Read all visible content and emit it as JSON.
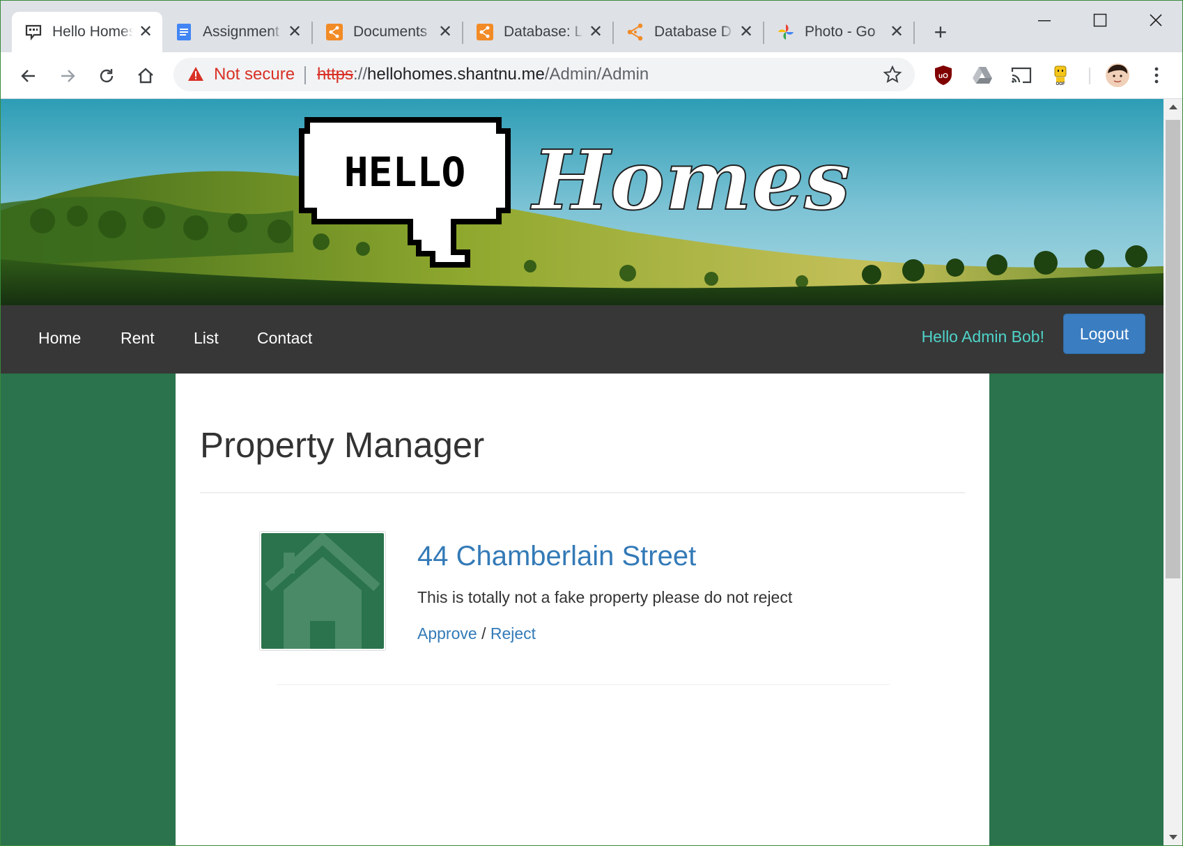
{
  "browser": {
    "tabs": [
      {
        "title": "Hello Homes",
        "icon": "hello-homes-favicon",
        "active": true
      },
      {
        "title": "Assignment",
        "icon": "google-docs-icon",
        "active": false
      },
      {
        "title": "Documents",
        "icon": "layers-icon",
        "active": false
      },
      {
        "title": "Database: L",
        "icon": "layers-icon",
        "active": false
      },
      {
        "title": "Database D",
        "icon": "share-nodes-icon",
        "active": false
      },
      {
        "title": "Photo - Go",
        "icon": "google-photos-icon",
        "active": false
      }
    ],
    "new_tab": "+",
    "window_controls": {
      "minimize": "—",
      "maximize": "☐",
      "close": "✕"
    },
    "security_label": "Not secure",
    "url": {
      "scheme": "https",
      "separator": "://",
      "host": "hellohomes.shantnu.me",
      "path": "/Admin/Admin"
    }
  },
  "site": {
    "logo": {
      "bubble_text": "HELLO",
      "script_text": "Homes"
    },
    "nav": [
      "Home",
      "Rent",
      "List",
      "Contact"
    ],
    "greeting": "Hello Admin Bob!",
    "logout_label": "Logout"
  },
  "page": {
    "title": "Property Manager",
    "properties": [
      {
        "name": "44 Chamberlain Street",
        "description": "This is totally not a fake property please do not reject",
        "approve_label": "Approve",
        "separator": "/",
        "reject_label": "Reject"
      }
    ]
  },
  "colors": {
    "page_background": "#2a734c",
    "navbar": "#373737",
    "greeting": "#4fd4c9",
    "logout_button": "#3a7dc1",
    "link": "#337ab7",
    "not_secure": "#d93025"
  }
}
